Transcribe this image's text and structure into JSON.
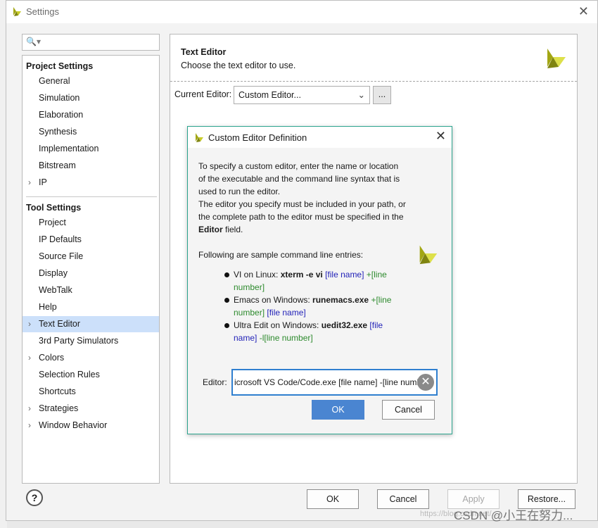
{
  "window": {
    "title": "Settings"
  },
  "search": {
    "placeholder": ""
  },
  "tree": {
    "project_header": "Project Settings",
    "project_items": [
      {
        "label": "General",
        "expandable": false
      },
      {
        "label": "Simulation",
        "expandable": false
      },
      {
        "label": "Elaboration",
        "expandable": false
      },
      {
        "label": "Synthesis",
        "expandable": false
      },
      {
        "label": "Implementation",
        "expandable": false
      },
      {
        "label": "Bitstream",
        "expandable": false
      },
      {
        "label": "IP",
        "expandable": true
      }
    ],
    "tool_header": "Tool Settings",
    "tool_items": [
      {
        "label": "Project",
        "expandable": false
      },
      {
        "label": "IP Defaults",
        "expandable": false
      },
      {
        "label": "Source File",
        "expandable": false
      },
      {
        "label": "Display",
        "expandable": false
      },
      {
        "label": "WebTalk",
        "expandable": false
      },
      {
        "label": "Help",
        "expandable": false
      },
      {
        "label": "Text Editor",
        "expandable": true,
        "selected": true
      },
      {
        "label": "3rd Party Simulators",
        "expandable": false
      },
      {
        "label": "Colors",
        "expandable": true
      },
      {
        "label": "Selection Rules",
        "expandable": false
      },
      {
        "label": "Shortcuts",
        "expandable": false
      },
      {
        "label": "Strategies",
        "expandable": true
      },
      {
        "label": "Window Behavior",
        "expandable": true
      }
    ]
  },
  "panel": {
    "title": "Text Editor",
    "subtitle": "Choose the text editor to use.",
    "current_editor_label": "Current Editor:",
    "current_editor_value": "Custom Editor...",
    "browse_label": "..."
  },
  "dialog": {
    "title": "Custom Editor Definition",
    "intro_lines": [
      "To specify a custom editor, enter the name or location",
      "of the executable and the command line syntax that is",
      "used to run the editor.",
      "The editor you specify must be included in your path, or",
      "the complete path to the editor must be specified in the"
    ],
    "editor_word": "Editor",
    "field_suffix": " field.",
    "samples_heading": "Following are sample command line entries:",
    "samples": [
      {
        "prefix": "VI on Linux: ",
        "cmd": "xterm -e vi",
        "arg1": " [file name]",
        "arg2": " +[line",
        "arg3": "number]",
        "line2_first": "arg3"
      },
      {
        "prefix": "Emacs on Windows: ",
        "cmd": "runemacs.exe",
        "arg1": " +[line",
        "arg2": "number]",
        "arg3": " [file name]"
      },
      {
        "prefix": "Ultra Edit on Windows: ",
        "cmd": "uedit32.exe",
        "arg1": " [file",
        "arg2": "name]",
        "arg3": " -l[line number]"
      }
    ],
    "editor_label": "Editor:",
    "editor_value": "icrosoft VS Code/Code.exe [file name] -[line number]",
    "ok_label": "OK",
    "cancel_label": "Cancel"
  },
  "footer": {
    "help_label": "?",
    "ok_label": "OK",
    "cancel_label": "Cancel",
    "apply_label": "Apply",
    "restore_label": "Restore..."
  },
  "watermark": {
    "text": "CSDN @小王在努力...",
    "faint": "https://blog.csdn.net/..."
  },
  "colors": {
    "accent": "#4a85d1",
    "selection": "#cce0fa",
    "dialog_border": "#2aa38d",
    "logo": "#b3b91a"
  }
}
